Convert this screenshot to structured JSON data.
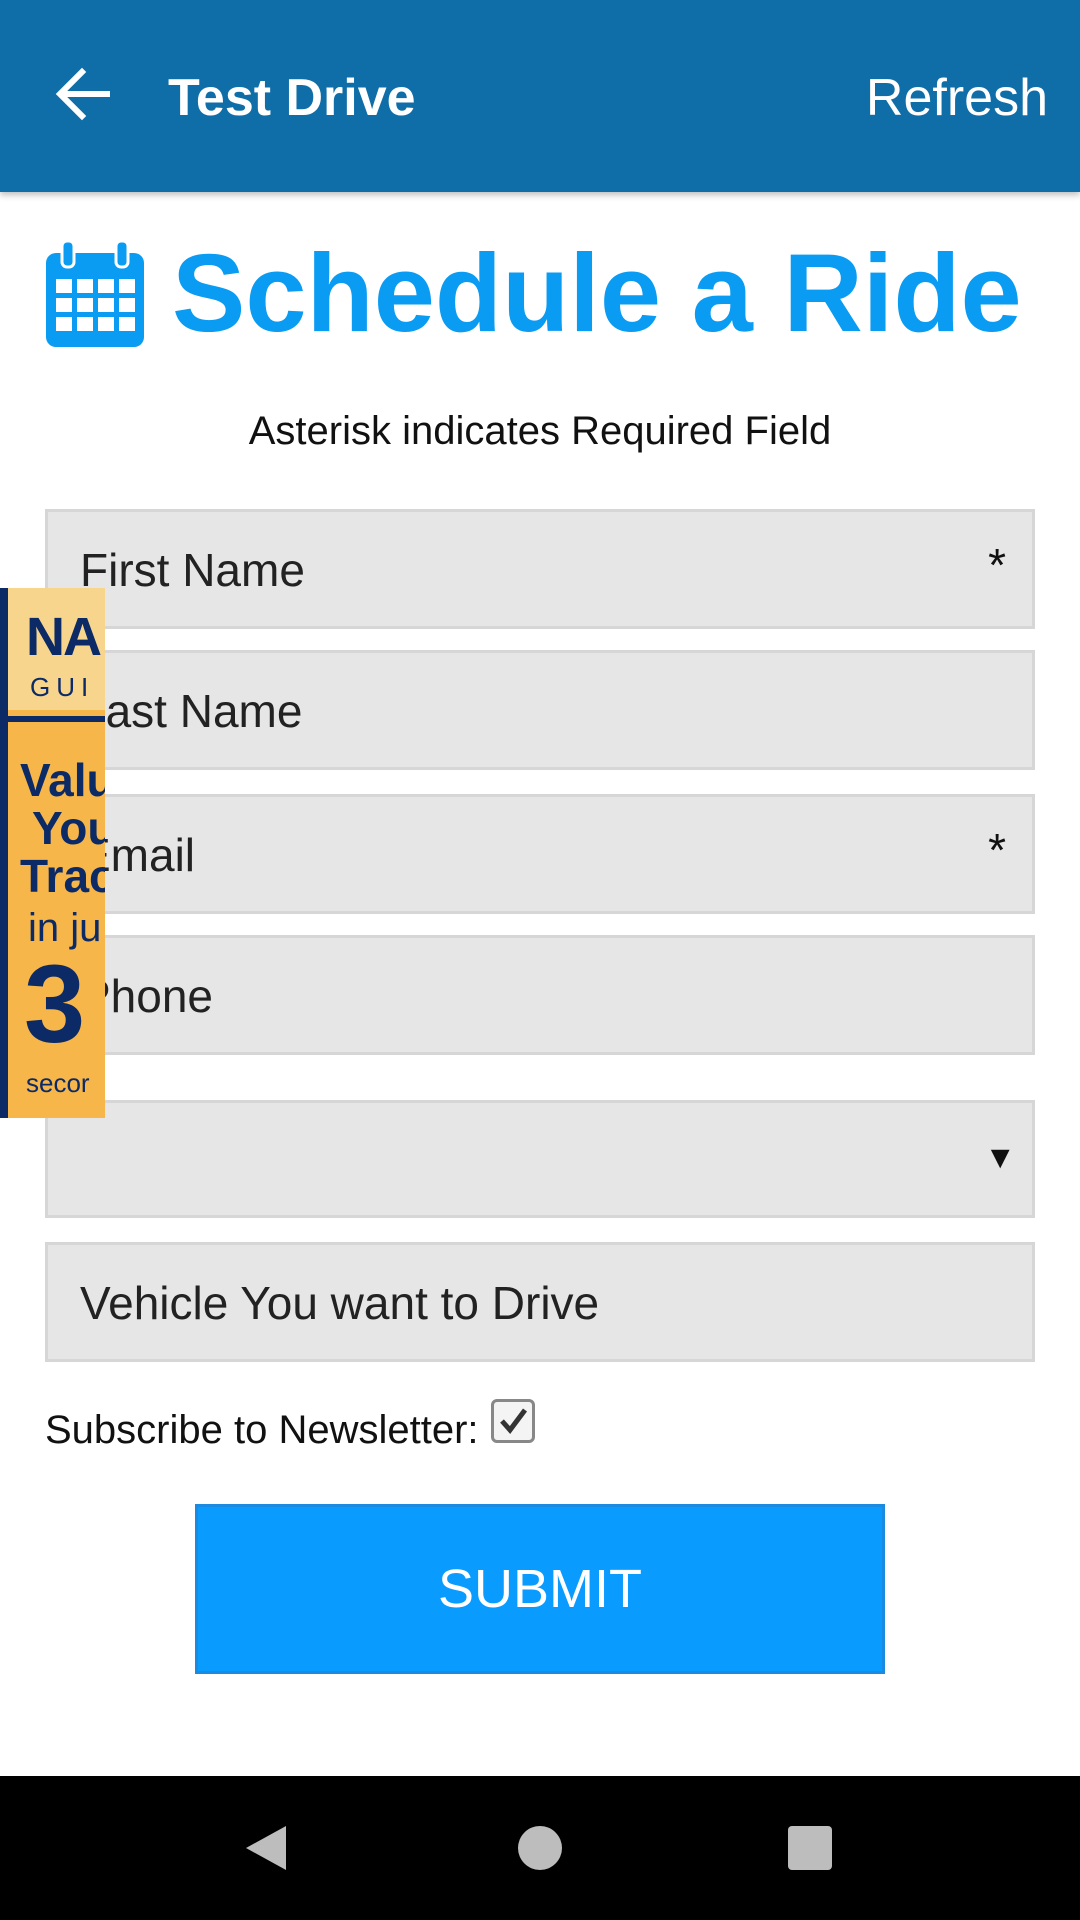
{
  "app_bar": {
    "title": "Test Drive",
    "refresh_label": "Refresh",
    "back_icon": "arrow-left-icon",
    "color": "#0f6ea8"
  },
  "form": {
    "heading": "Schedule a Ride",
    "heading_icon": "calendar-icon",
    "heading_color": "#0a9bf2",
    "required_note": "Asterisk indicates Required Field",
    "fields": {
      "first_name": {
        "label": "First Name",
        "required": "*"
      },
      "last_name": {
        "label": "Last Name"
      },
      "email": {
        "label": "Email",
        "required": "*"
      },
      "phone": {
        "label": "Phone"
      },
      "dropdown": {
        "value": "",
        "caret": "▼"
      },
      "vehicle": {
        "label": "Vehicle You want to Drive"
      }
    },
    "subscribe_label": "Subscribe to Newsletter:",
    "subscribe_checked": true,
    "submit_label": "SUBMIT",
    "submit_color": "#0a9bff"
  },
  "ad_banner": {
    "brand": "NA",
    "sub": "GUI",
    "line1": "Valu",
    "line2": "You",
    "line3": "Trac",
    "small": "in ju",
    "big": "3",
    "seconds": "secor"
  },
  "nav_bar": {
    "back_icon": "nav-back-icon",
    "home_icon": "nav-home-icon",
    "recents_icon": "nav-recents-icon"
  }
}
